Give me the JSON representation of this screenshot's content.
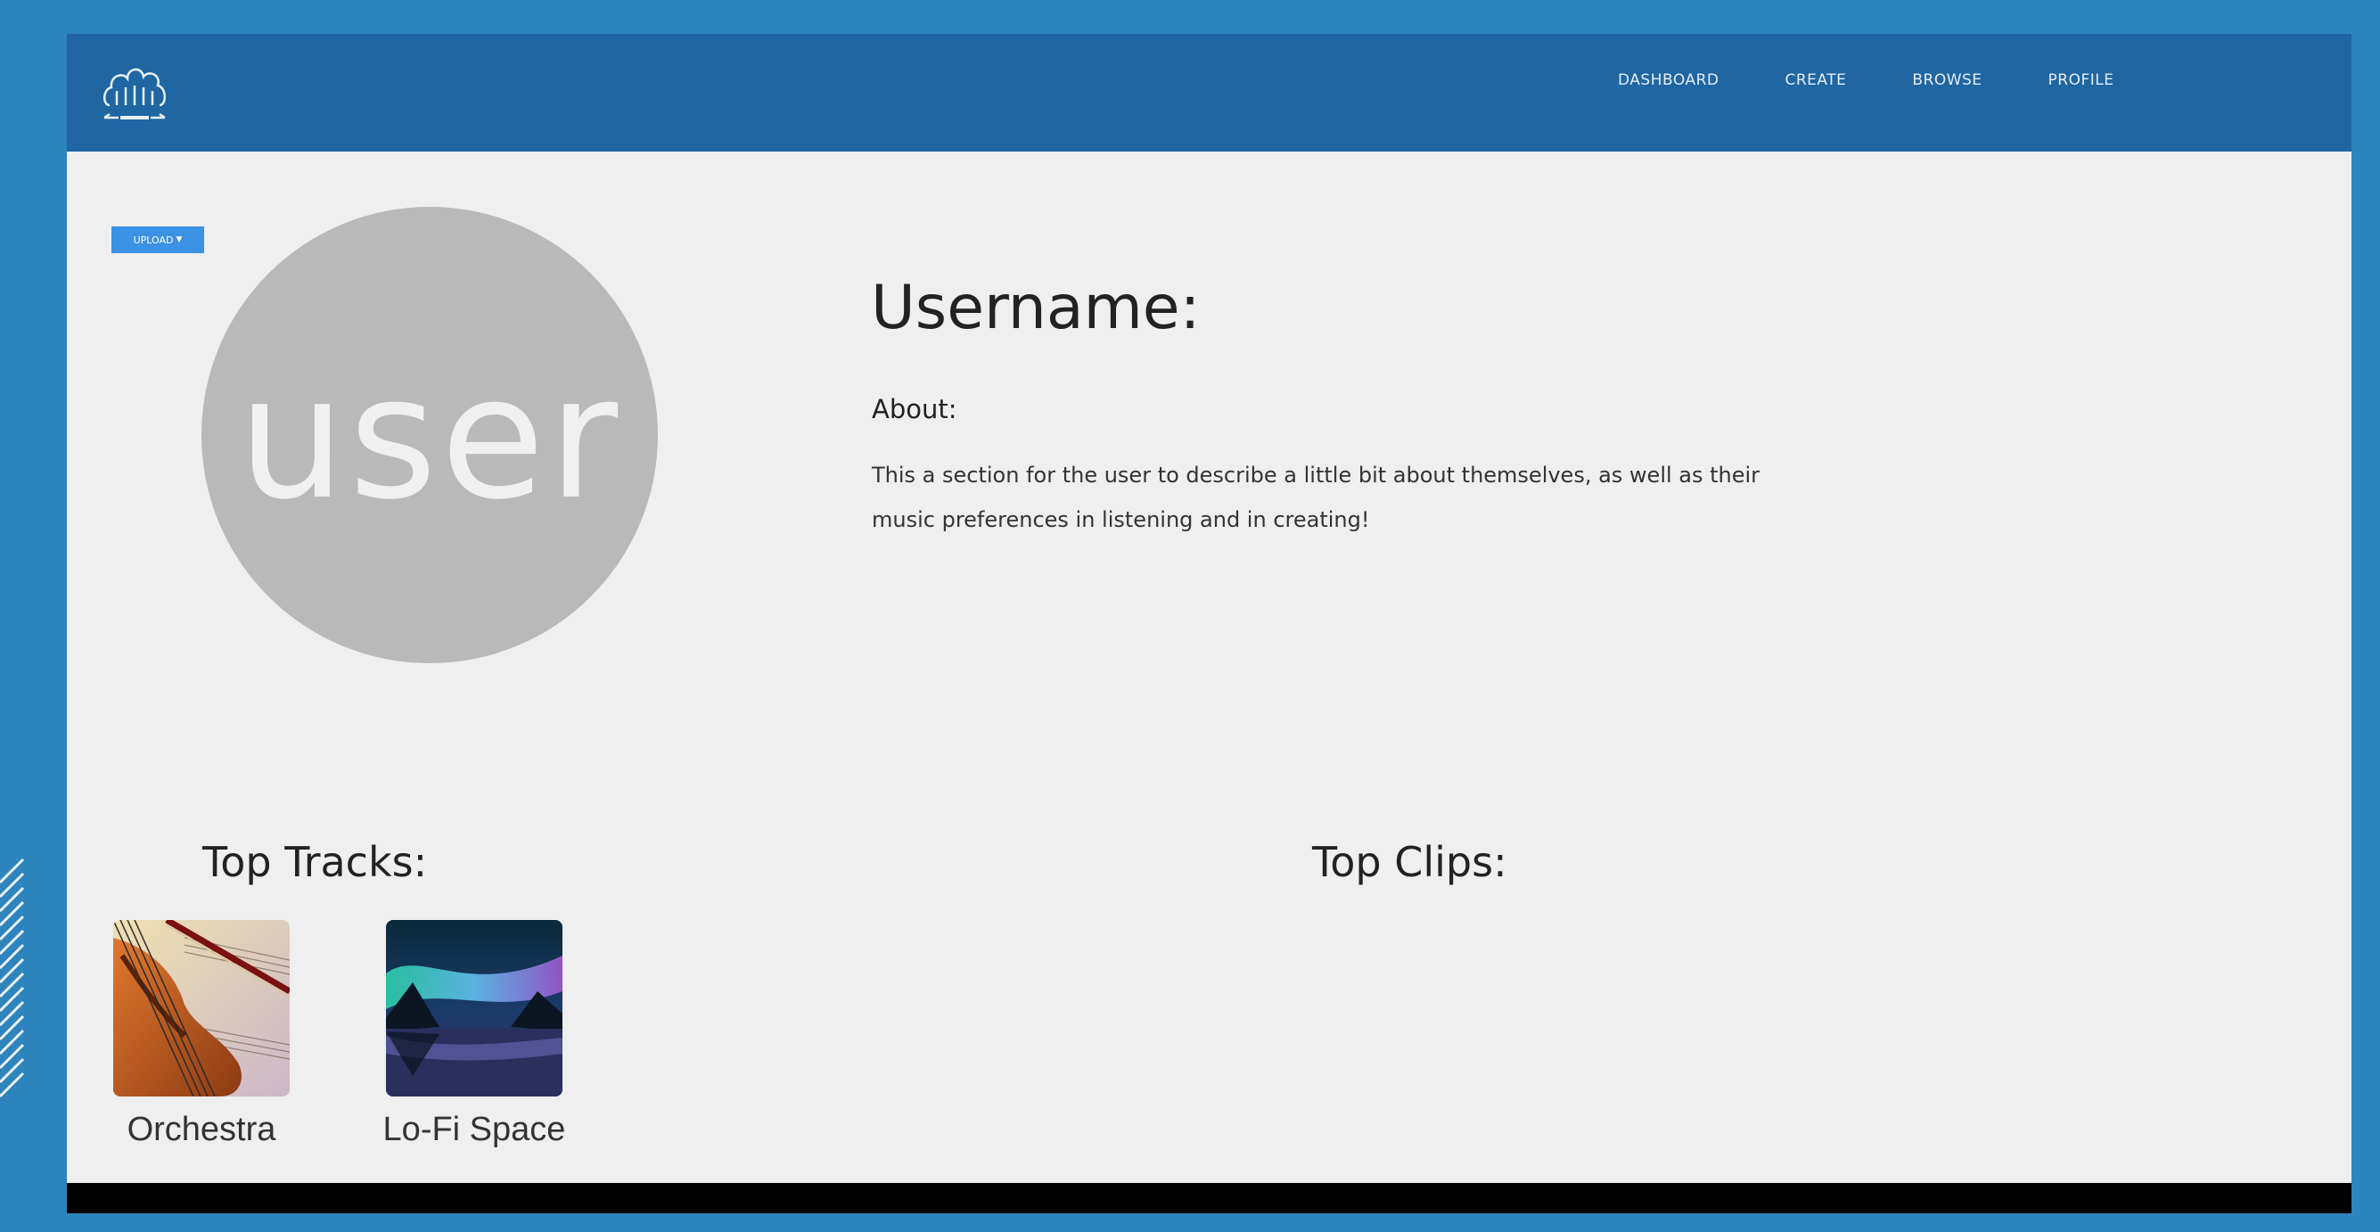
{
  "colors": {
    "background_frame": "#2e84bd",
    "navbar": "#1f66a3",
    "page": "#efefef",
    "button": "#3b91e3",
    "avatar": "#b9b9b9"
  },
  "navbar": {
    "logo_icon": "cloud-logo",
    "links": [
      "DASHBOARD",
      "CREATE",
      "BROWSE",
      "PROFILE"
    ]
  },
  "profile": {
    "upload_label": "UPLOAD",
    "avatar_text": "user",
    "username_label": "Username:",
    "about_heading": "About:",
    "about_text": "This a section for the user to describe a little bit about themselves, as well as their music preferences in listening and in creating!"
  },
  "top_tracks": {
    "title": "Top Tracks:",
    "items": [
      {
        "label": "Orchestra",
        "art_icon": "violin-sheet-music-art"
      },
      {
        "label": "Lo-Fi Space",
        "art_icon": "aurora-lake-art"
      }
    ]
  },
  "top_clips": {
    "title": "Top Clips:"
  }
}
